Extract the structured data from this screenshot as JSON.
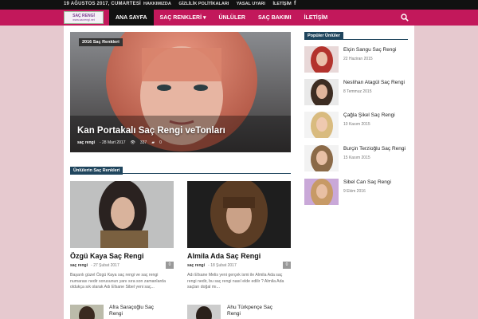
{
  "topbar": {
    "date": "19 AĞUSTOS 2017, CUMARTESİ",
    "links": [
      "HAKKIMIZDA",
      "GİZLİLİK POLİTİKALARI",
      "YASAL UYARI",
      "İLETİŞİM"
    ],
    "social_icon": "facebook-icon"
  },
  "logo": {
    "line1": "SAÇ RENGİ",
    "line2": "www.sacrengi.net"
  },
  "nav": {
    "items": [
      "ANA SAYFA",
      "SAÇ RENKLERİ ▾",
      "ÜNLÜLER",
      "SAÇ BAKIMI",
      "İLETİŞİM"
    ],
    "active_index": 0,
    "search_icon": "search-icon"
  },
  "hero": {
    "badge": "2016 Saç Renkleri",
    "title": "Kan Portakalı Saç Rengi veTonları",
    "author": "saç rengi",
    "date": "- 28 Mart 2017",
    "views": "337",
    "comments": "0"
  },
  "section": {
    "label": "Ünlülerin Saç Renkleri"
  },
  "cards": [
    {
      "title": "Özgü Kaya Saç Rengi",
      "author": "saç rengi",
      "date": "- 27 Şubat 2017",
      "comments": "0",
      "excerpt": "Başarılı güzel Özgü Kaya saç rengi ve saç rengi numarası nedir sorusunun yanı sıra son zamanlarda oldukça sık olarak Adı Efsane Sibel yeni saç..."
    },
    {
      "title": "Almila Ada Saç Rengi",
      "author": "saç rengi",
      "date": "- 18 Şubat 2017",
      "comments": "0",
      "excerpt": "Adı Efsane Melis yeni gerçek ismi ile Almila Ada saç rengi nedir, bu saç rengi nasıl elde edilir ? Almila Ada saçları doğal mı..."
    }
  ],
  "small_posts": [
    {
      "title": "Afra Saraçoğlu Saç Rengi"
    },
    {
      "title": "Ahu Türkpençe Saç Rengi"
    }
  ],
  "sidebar": {
    "label": "Popüler Ünlüler",
    "items": [
      {
        "name": "Elçin Sangu Saç Rengi",
        "date": "22 Haziran 2015"
      },
      {
        "name": "Neslihan Atagül Saç Rengi",
        "date": "8 Temmuz 2015"
      },
      {
        "name": "Çağla Şikel Saç Rengi",
        "date": "10 Kasım 2015"
      },
      {
        "name": "Burçin Terzioğlu Saç Rengi",
        "date": "15 Kasım 2015"
      },
      {
        "name": "Sibel Can Saç Rengi",
        "date": "9 Ekim 2016"
      }
    ]
  },
  "colors": {
    "nav": "#c2185b",
    "page_bg": "#e6c9cf",
    "label_bg": "#20465e"
  }
}
